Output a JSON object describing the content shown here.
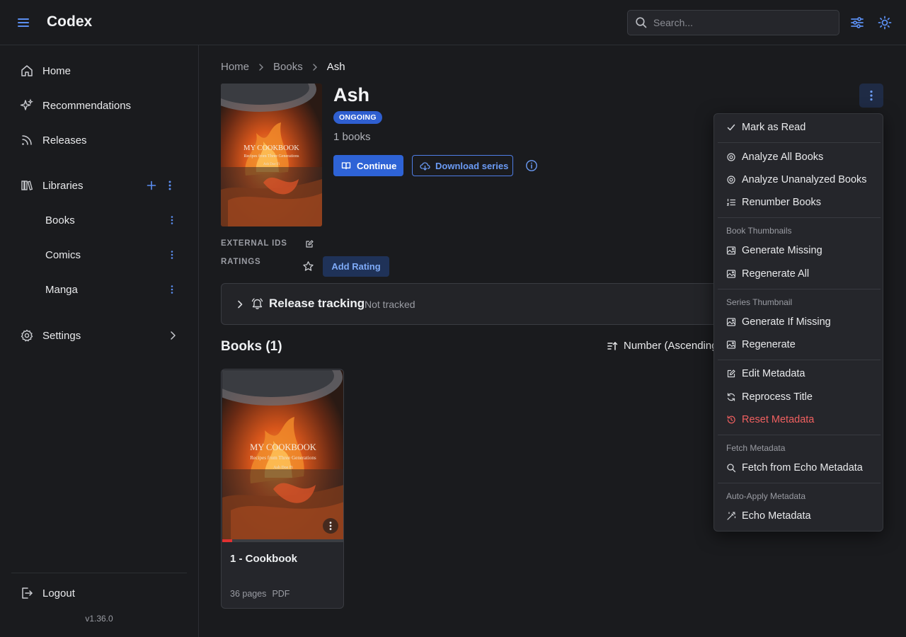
{
  "app": {
    "title": "Codex",
    "version": "v1.36.0"
  },
  "header": {
    "search_placeholder": "Search..."
  },
  "sidebar": {
    "nav": [
      {
        "label": "Home"
      },
      {
        "label": "Recommendations"
      },
      {
        "label": "Releases"
      }
    ],
    "libraries_label": "Libraries",
    "libraries": [
      {
        "label": "Books"
      },
      {
        "label": "Comics"
      },
      {
        "label": "Manga"
      }
    ],
    "settings_label": "Settings",
    "logout_label": "Logout"
  },
  "breadcrumb": [
    "Home",
    "Books",
    "Ash"
  ],
  "series": {
    "title": "Ash",
    "status": "ONGOING",
    "books_count": "1 books",
    "continue_label": "Continue",
    "download_label": "Download series",
    "external_ids_label": "EXTERNAL IDS",
    "ratings_label": "RATINGS",
    "add_rating_label": "Add Rating"
  },
  "cover": {
    "title": "MY COOKBOOK",
    "subtitle": "Recipes from Three Generations",
    "author": "Ash Doe Fi"
  },
  "release_tracking": {
    "title": "Release tracking",
    "status": "Not tracked"
  },
  "books_section": {
    "heading": "Books (1)",
    "sort_label": "Number (Ascending)",
    "books": [
      {
        "title": "1 - Cookbook",
        "pages": "36 pages",
        "format": "PDF",
        "progress": 0.08
      }
    ]
  },
  "menu": {
    "mark_as_read": "Mark as Read",
    "analyze_all": "Analyze All Books",
    "analyze_unanalyzed": "Analyze Unanalyzed Books",
    "renumber": "Renumber Books",
    "book_thumbnails_header": "Book Thumbnails",
    "generate_missing": "Generate Missing",
    "regenerate_all": "Regenerate All",
    "series_thumbnail_header": "Series Thumbnail",
    "generate_if_missing": "Generate If Missing",
    "regenerate": "Regenerate",
    "edit_metadata": "Edit Metadata",
    "reprocess_title": "Reprocess Title",
    "reset_metadata": "Reset Metadata",
    "fetch_metadata_header": "Fetch Metadata",
    "fetch_from_echo": "Fetch from Echo Metadata",
    "auto_apply_header": "Auto-Apply Metadata",
    "echo_metadata": "Echo Metadata"
  },
  "colors": {
    "accent": "#2e63d6",
    "accent_text": "#6b9bf5",
    "danger": "#f06060",
    "background": "#1a1b1e"
  }
}
